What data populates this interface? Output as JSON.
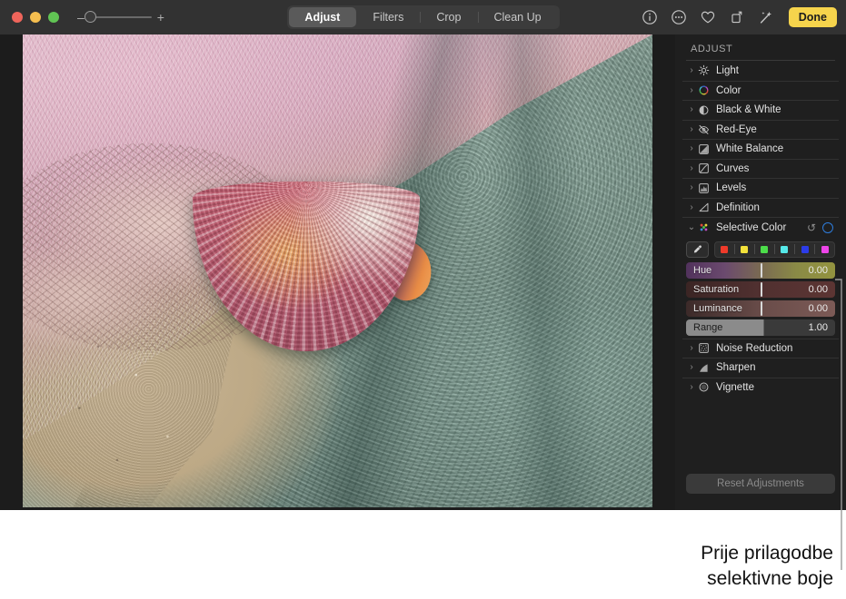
{
  "window": {
    "traffic_lights": [
      "close",
      "minimize",
      "zoom"
    ],
    "zoom_control": {
      "minus": "–",
      "plus": "+",
      "value": 0
    }
  },
  "toolbar": {
    "tabs": [
      {
        "label": "Adjust",
        "active": true
      },
      {
        "label": "Filters",
        "active": false
      },
      {
        "label": "Crop",
        "active": false
      },
      {
        "label": "Clean Up",
        "active": false
      }
    ],
    "icons": [
      {
        "name": "info-icon",
        "glyph": "info"
      },
      {
        "name": "more-options-icon",
        "glyph": "ellipsis"
      },
      {
        "name": "favorite-icon",
        "glyph": "heart"
      },
      {
        "name": "rotate-icon",
        "glyph": "rotate"
      },
      {
        "name": "auto-enhance-icon",
        "glyph": "wand"
      }
    ],
    "done_label": "Done",
    "done_color": "#f6d44c"
  },
  "sidebar": {
    "title": "ADJUST",
    "rows_top": [
      {
        "label": "Light",
        "icon": "brightness-icon",
        "expanded": false
      },
      {
        "label": "Color",
        "icon": "color-wheel-icon",
        "expanded": false
      },
      {
        "label": "Black & White",
        "icon": "contrast-icon",
        "expanded": false
      },
      {
        "label": "Red-Eye",
        "icon": "eye-slash-icon",
        "expanded": false
      },
      {
        "label": "White Balance",
        "icon": "white-balance-icon",
        "expanded": false
      },
      {
        "label": "Curves",
        "icon": "curves-icon",
        "expanded": false
      },
      {
        "label": "Levels",
        "icon": "levels-icon",
        "expanded": false
      },
      {
        "label": "Definition",
        "icon": "definition-icon",
        "expanded": false
      }
    ],
    "selective_color": {
      "label": "Selective Color",
      "icon": "selective-color-icon",
      "expanded": true,
      "reset_icon": "reset-arrow-icon",
      "toggle_icon": "blue-ring-toggle",
      "toggle_color": "#2e7ddd",
      "eyedropper_icon": "eyedropper-icon",
      "swatches": [
        {
          "name": "red",
          "color": "#ef3a2a"
        },
        {
          "name": "yellow",
          "color": "#f3e13a"
        },
        {
          "name": "green",
          "color": "#4cdd4a"
        },
        {
          "name": "cyan",
          "color": "#55e8e8"
        },
        {
          "name": "blue",
          "color": "#2c3ce8"
        },
        {
          "name": "magenta",
          "color": "#ee45e8"
        }
      ],
      "sliders": [
        {
          "name": "hue",
          "label": "Hue",
          "value": "0.00",
          "knob_pct": 50
        },
        {
          "name": "saturation",
          "label": "Saturation",
          "value": "0.00",
          "knob_pct": 50
        },
        {
          "name": "luminance",
          "label": "Luminance",
          "value": "0.00",
          "knob_pct": 50
        },
        {
          "name": "range",
          "label": "Range",
          "value": "1.00",
          "knob_pct": 52
        }
      ]
    },
    "rows_bottom": [
      {
        "label": "Noise Reduction",
        "icon": "noise-reduction-icon",
        "expanded": false
      },
      {
        "label": "Sharpen",
        "icon": "sharpen-icon",
        "expanded": false
      },
      {
        "label": "Vignette",
        "icon": "vignette-icon",
        "expanded": false
      }
    ],
    "reset_button": "Reset Adjustments"
  },
  "photo": {
    "alt_name": "scallop-shell-on-teal-towel"
  },
  "caption": {
    "line1": "Prije prilagodbe",
    "line2": "selektivne boje"
  }
}
